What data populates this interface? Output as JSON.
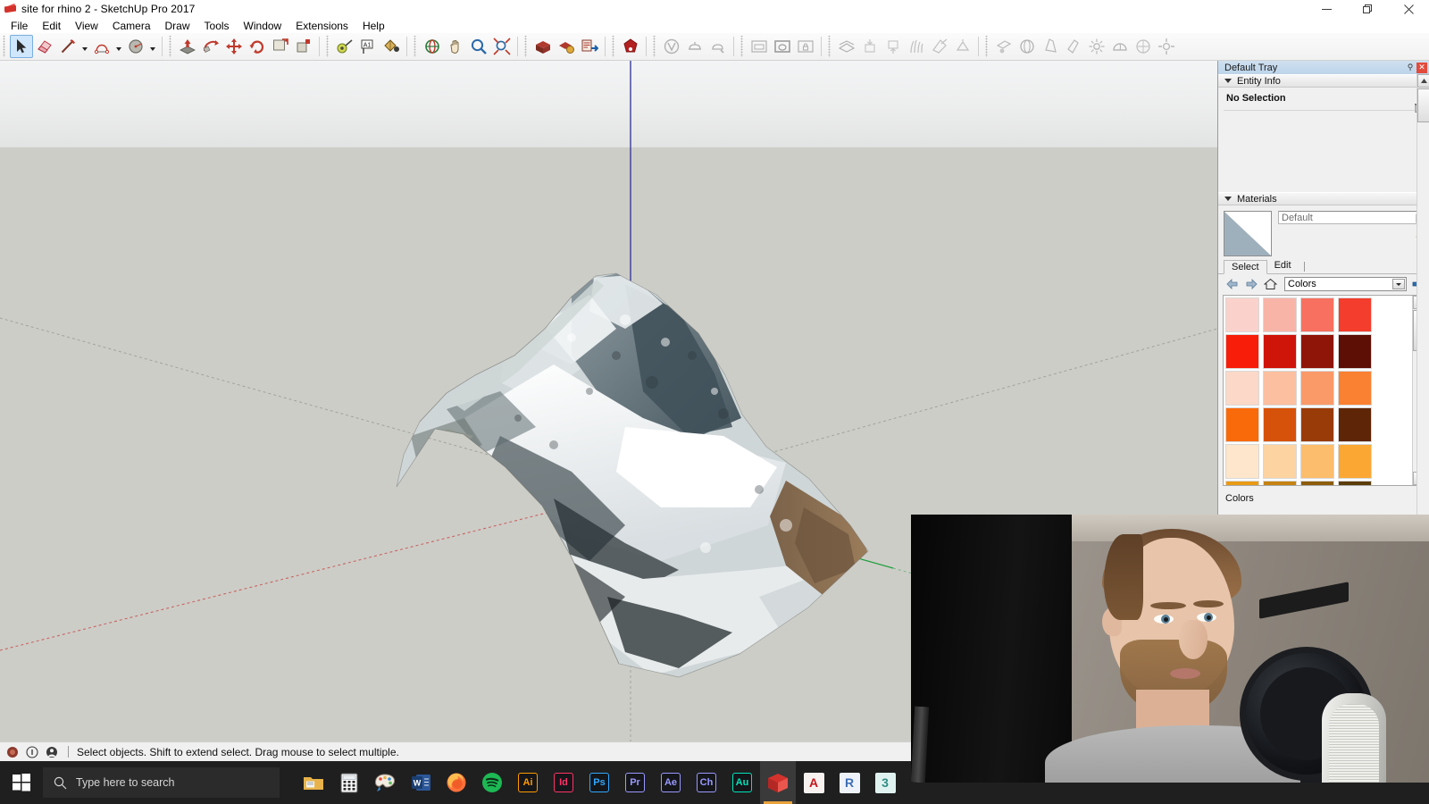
{
  "window": {
    "title": "site for rhino 2 - SketchUp Pro 2017",
    "app_icon": "sketchup-icon",
    "minimize_label": "Minimize",
    "restore_label": "Restore",
    "close_label": "Close"
  },
  "menu": {
    "items": [
      {
        "label": "File"
      },
      {
        "label": "Edit"
      },
      {
        "label": "View"
      },
      {
        "label": "Camera"
      },
      {
        "label": "Draw"
      },
      {
        "label": "Tools"
      },
      {
        "label": "Window"
      },
      {
        "label": "Extensions"
      },
      {
        "label": "Help"
      }
    ]
  },
  "toolbar": {
    "groups": [
      {
        "name": "principal",
        "tools": [
          {
            "name": "select-tool",
            "label": "Select",
            "active": true,
            "dim": false,
            "arrow": false
          },
          {
            "name": "eraser-tool",
            "label": "Eraser",
            "active": false,
            "dim": false,
            "arrow": false
          },
          {
            "name": "line-tool",
            "label": "Line",
            "active": false,
            "dim": false,
            "arrow": true
          },
          {
            "name": "arc-tool",
            "label": "Arc",
            "active": false,
            "dim": false,
            "arrow": true
          },
          {
            "name": "circle-tool",
            "label": "Circle",
            "active": false,
            "dim": false,
            "arrow": true
          }
        ]
      },
      {
        "name": "edit",
        "tools": [
          {
            "name": "pushpull-tool",
            "label": "Push/Pull",
            "active": false,
            "dim": false,
            "arrow": false
          },
          {
            "name": "followme-tool",
            "label": "Follow Me",
            "active": false,
            "dim": false,
            "arrow": false
          },
          {
            "name": "move-tool",
            "label": "Move",
            "active": false,
            "dim": false,
            "arrow": false
          },
          {
            "name": "rotate-tool",
            "label": "Rotate",
            "active": false,
            "dim": false,
            "arrow": false
          },
          {
            "name": "offset-tool",
            "label": "Offset",
            "active": false,
            "dim": false,
            "arrow": false
          },
          {
            "name": "scale-tool",
            "label": "Scale",
            "active": false,
            "dim": false,
            "arrow": false
          }
        ]
      },
      {
        "name": "construction",
        "tools": [
          {
            "name": "tape-measure-tool",
            "label": "Tape Measure",
            "active": false,
            "dim": false,
            "arrow": false
          },
          {
            "name": "text-tool",
            "label": "Text",
            "active": false,
            "dim": false,
            "arrow": false
          },
          {
            "name": "paint-bucket-tool",
            "label": "Paint Bucket",
            "active": false,
            "dim": false,
            "arrow": false
          }
        ]
      },
      {
        "name": "camera",
        "tools": [
          {
            "name": "orbit-tool",
            "label": "Orbit",
            "active": false,
            "dim": false,
            "arrow": false
          },
          {
            "name": "pan-tool",
            "label": "Pan",
            "active": false,
            "dim": false,
            "arrow": false
          },
          {
            "name": "zoom-tool",
            "label": "Zoom",
            "active": false,
            "dim": false,
            "arrow": false
          },
          {
            "name": "zoom-extents-tool",
            "label": "Zoom Extents",
            "active": false,
            "dim": false,
            "arrow": false
          }
        ]
      },
      {
        "name": "warehouse",
        "tools": [
          {
            "name": "warehouse-3d-tool",
            "label": "3D Warehouse",
            "active": false,
            "dim": false,
            "arrow": false
          },
          {
            "name": "share-model-tool",
            "label": "Share Model",
            "active": false,
            "dim": false,
            "arrow": false
          },
          {
            "name": "extension-warehouse-tool",
            "label": "Extension Warehouse",
            "active": false,
            "dim": false,
            "arrow": false
          }
        ]
      },
      {
        "name": "vray-main",
        "tools": [
          {
            "name": "vray-render-tool",
            "label": "Render",
            "active": false,
            "dim": false,
            "arrow": false
          }
        ]
      },
      {
        "name": "vray-render",
        "tools": [
          {
            "name": "vray-render-interactive-icon",
            "label": "Render Interactive",
            "active": false,
            "dim": true,
            "arrow": false
          },
          {
            "name": "vray-asset-editor-icon",
            "label": "Asset Editor",
            "active": false,
            "dim": true,
            "arrow": false
          },
          {
            "name": "vray-material-picker-icon",
            "label": "Material Picker",
            "active": false,
            "dim": true,
            "arrow": false
          }
        ]
      },
      {
        "name": "vray-frame",
        "tools": [
          {
            "name": "vray-frame-buffer-icon",
            "label": "Frame Buffer",
            "active": false,
            "dim": true,
            "arrow": false
          },
          {
            "name": "vray-batch-render-icon",
            "label": "Batch Render",
            "active": false,
            "dim": true,
            "arrow": false
          },
          {
            "name": "vray-lock-camera-icon",
            "label": "Lock Camera",
            "active": false,
            "dim": true,
            "arrow": false
          }
        ]
      },
      {
        "name": "vray-geometry",
        "tools": [
          {
            "name": "vray-infinite-plane-icon",
            "label": "Infinite Plane",
            "active": false,
            "dim": true,
            "arrow": false
          },
          {
            "name": "vray-proxy-import-icon",
            "label": "Import Proxy",
            "active": false,
            "dim": true,
            "arrow": false
          },
          {
            "name": "vray-proxy-export-icon",
            "label": "Export Proxy",
            "active": false,
            "dim": true,
            "arrow": false
          },
          {
            "name": "vray-fur-icon",
            "label": "Fur",
            "active": false,
            "dim": true,
            "arrow": false
          },
          {
            "name": "vray-clipper-icon",
            "label": "Clipper",
            "active": false,
            "dim": true,
            "arrow": false
          },
          {
            "name": "vray-mesh-light-icon",
            "label": "Mesh Light",
            "active": false,
            "dim": true,
            "arrow": false
          }
        ]
      },
      {
        "name": "vray-lights",
        "tools": [
          {
            "name": "vray-rectangle-light-icon",
            "label": "Rectangle Light",
            "active": false,
            "dim": true,
            "arrow": false
          },
          {
            "name": "vray-sphere-light-icon",
            "label": "Sphere Light",
            "active": false,
            "dim": true,
            "arrow": false
          },
          {
            "name": "vray-spot-light-icon",
            "label": "Spot Light",
            "active": false,
            "dim": true,
            "arrow": false
          },
          {
            "name": "vray-ies-light-icon",
            "label": "IES Light",
            "active": false,
            "dim": true,
            "arrow": false
          },
          {
            "name": "vray-omni-light-icon",
            "label": "Omni Light",
            "active": false,
            "dim": true,
            "arrow": false
          },
          {
            "name": "vray-dome-light-icon",
            "label": "Dome Light",
            "active": false,
            "dim": true,
            "arrow": false
          },
          {
            "name": "vray-sun-light-icon",
            "label": "Sun Light",
            "active": false,
            "dim": true,
            "arrow": false
          },
          {
            "name": "vray-settings-icon",
            "label": "Settings",
            "active": false,
            "dim": true,
            "arrow": false
          }
        ]
      }
    ]
  },
  "viewport": {
    "model_name": "mountain-terrain-mesh",
    "background_ground": "#cdcdc8",
    "background_sky": "#eceded",
    "axis_colors": {
      "red": "#c8544f",
      "green": "#1f9e3c",
      "blue": "#2b2f93"
    }
  },
  "tray": {
    "title": "Default Tray",
    "pin_label": "Pin",
    "close_label": "Close",
    "entity_info": {
      "title": "Entity Info",
      "collapse_label": "Collapse",
      "close_label": "Close",
      "selection_status": "No Selection"
    },
    "materials": {
      "title": "Materials",
      "collapse_label": "Collapse",
      "close_label": "Close",
      "current_material": "Default",
      "tabs": [
        {
          "label": "Select",
          "active": true
        },
        {
          "label": "Edit",
          "active": false
        }
      ],
      "library": "Colors",
      "section_label": "Colors",
      "back_label": "Back",
      "forward_label": "Forward",
      "home_label": "Home",
      "details_label": "Details",
      "swatches": [
        "#fad2cb",
        "#f9b4a8",
        "#f8705f",
        "#f43d2c",
        "#f81d09",
        "#cf1409",
        "#8f1508",
        "#5d0f06",
        "#fbd8c8",
        "#fcbf9f",
        "#fb9a69",
        "#fb8132",
        "#f96a0b",
        "#d6520a",
        "#993b09",
        "#5e2506",
        "#fde6cb",
        "#fdd3a1",
        "#fcbd6c",
        "#fba733",
        "#e89a14",
        "#c58312",
        "#8d5d0c",
        "#5b3c07"
      ]
    }
  },
  "statusbar": {
    "message": "Select objects. Shift to extend select. Drag mouse to select multiple.",
    "icons": [
      {
        "name": "sketchup-status-icon"
      },
      {
        "name": "info-circle-icon"
      },
      {
        "name": "account-icon"
      }
    ]
  },
  "taskbar": {
    "start_label": "Start",
    "search_placeholder": "Type here to search",
    "apps": [
      {
        "name": "file-explorer-icon",
        "label": "File Explorer",
        "kind": "explorer",
        "active": false
      },
      {
        "name": "calculator-icon",
        "label": "Calculator",
        "kind": "calculator",
        "active": false
      },
      {
        "name": "paint-icon",
        "label": "Paint",
        "kind": "paint",
        "active": false
      },
      {
        "name": "word-icon",
        "label": "Word",
        "kind": "word",
        "active": false
      },
      {
        "name": "firefox-icon",
        "label": "Firefox",
        "kind": "firefox",
        "active": false
      },
      {
        "name": "spotify-icon",
        "label": "Spotify",
        "kind": "spotify",
        "active": false
      },
      {
        "name": "illustrator-icon",
        "label": "Ai",
        "kind": "adobe",
        "color": "#ff9a00",
        "active": false
      },
      {
        "name": "indesign-icon",
        "label": "Id",
        "kind": "adobe",
        "color": "#ff3366",
        "active": false
      },
      {
        "name": "photoshop-icon",
        "label": "Ps",
        "kind": "adobe",
        "color": "#31a8ff",
        "active": false
      },
      {
        "name": "premiere-icon",
        "label": "Pr",
        "kind": "adobe",
        "color": "#9999ff",
        "active": false
      },
      {
        "name": "aftereffects-icon",
        "label": "Ae",
        "kind": "adobe",
        "color": "#9999ff",
        "active": false
      },
      {
        "name": "character-animator-icon",
        "label": "Ch",
        "kind": "adobe",
        "color": "#9999ff",
        "active": false
      },
      {
        "name": "audition-icon",
        "label": "Au",
        "kind": "adobe",
        "color": "#00e4bb",
        "active": false
      },
      {
        "name": "sketchup-taskbar-icon",
        "label": "SketchUp",
        "kind": "sketchup",
        "active": true
      },
      {
        "name": "autocad-icon",
        "label": "A",
        "kind": "square",
        "color": "#c4161c",
        "bg": "#f7f2f0",
        "active": false
      },
      {
        "name": "rhino-icon",
        "label": "R",
        "kind": "square",
        "color": "#3d6fb5",
        "bg": "#eef3fa",
        "active": false
      },
      {
        "name": "3dsmax-icon",
        "label": "3",
        "kind": "square",
        "color": "#2e8b84",
        "bg": "#dff2ef",
        "active": false
      }
    ]
  },
  "webcam": {
    "name": "webcam-overlay",
    "description": "Presenter speaking into a microphone"
  }
}
